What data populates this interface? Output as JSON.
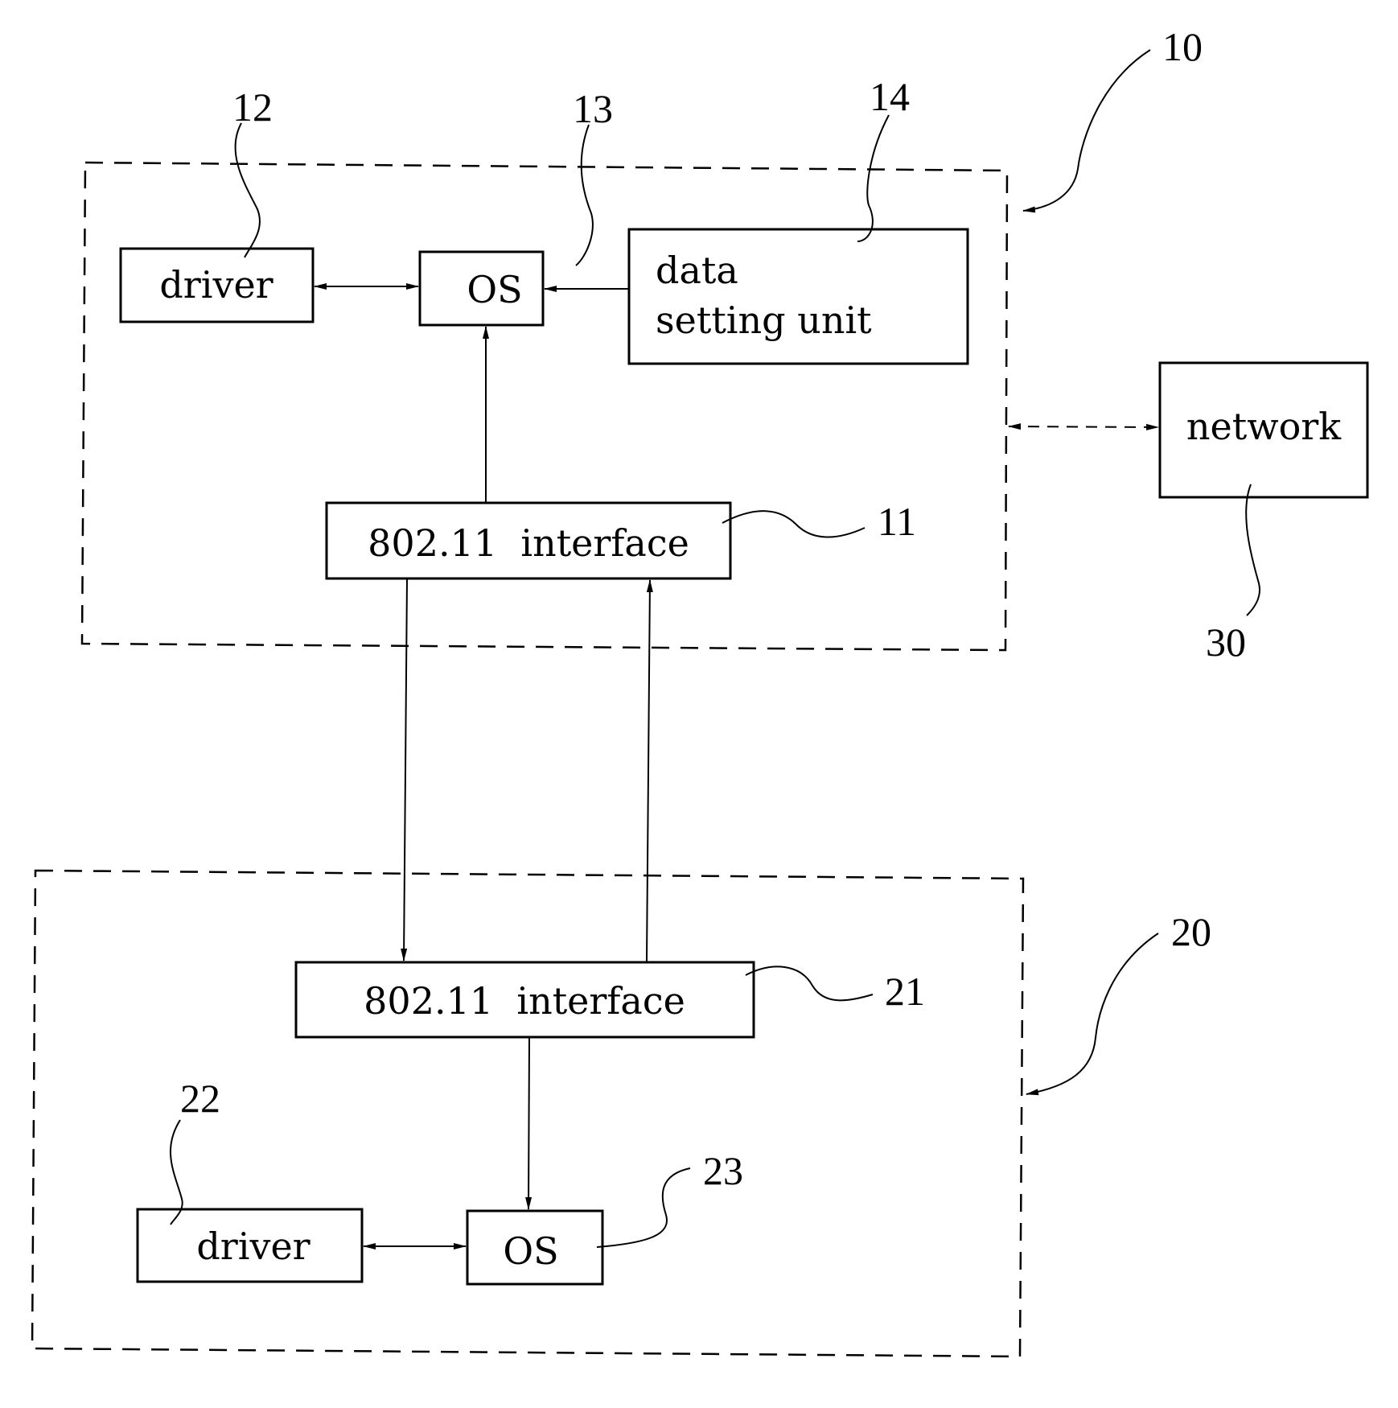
{
  "diagram": {
    "title": "",
    "devices": [
      {
        "ref": "10",
        "name": "device-10"
      },
      {
        "ref": "20",
        "name": "device-20"
      }
    ],
    "blocks": {
      "driver_12": {
        "ref": "12",
        "label": "driver"
      },
      "os_13": {
        "ref": "13",
        "label": "OS"
      },
      "data_setting_14": {
        "ref": "14",
        "label_line1": "data",
        "label_line2": "setting unit"
      },
      "interface_11": {
        "ref": "11",
        "label": "802.11  interface"
      },
      "network_30": {
        "ref": "30",
        "label": "network"
      },
      "interface_21": {
        "ref": "21",
        "label": "802.11  interface"
      },
      "driver_22": {
        "ref": "22",
        "label": "driver"
      },
      "os_23": {
        "ref": "23",
        "label": "OS"
      }
    },
    "connections": [
      {
        "from": "driver_12",
        "to": "os_13",
        "type": "bidirectional"
      },
      {
        "from": "data_setting_14",
        "to": "os_13",
        "type": "directed"
      },
      {
        "from": "interface_11",
        "to": "os_13",
        "type": "directed"
      },
      {
        "from": "interface_11",
        "to": "interface_21",
        "type": "directed"
      },
      {
        "from": "interface_21",
        "to": "interface_11",
        "type": "directed"
      },
      {
        "from": "device_10",
        "to": "network_30",
        "type": "bidirectional-dashed"
      },
      {
        "from": "interface_21",
        "to": "os_23",
        "type": "directed"
      },
      {
        "from": "driver_22",
        "to": "os_23",
        "type": "bidirectional"
      }
    ]
  }
}
